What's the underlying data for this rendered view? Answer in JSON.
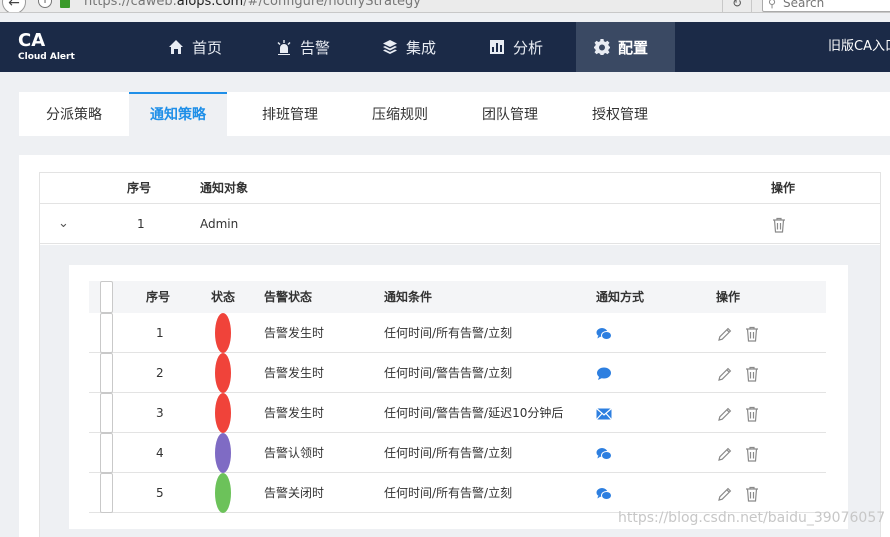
{
  "browser": {
    "url_prefix": "https://caweb.",
    "url_host": "alops.com",
    "url_path": "/#/configure/notifyStrategy",
    "search_placeholder": "Search"
  },
  "nav": {
    "logo_main": "CA",
    "logo_sub": "Cloud Alert",
    "items": [
      {
        "label": "首页",
        "icon": "home-icon"
      },
      {
        "label": "告警",
        "icon": "alarm-icon"
      },
      {
        "label": "集成",
        "icon": "layers-icon"
      },
      {
        "label": "分析",
        "icon": "chart-icon"
      },
      {
        "label": "配置",
        "icon": "gear-icon",
        "active": true
      }
    ],
    "right_link": "旧版CA入口"
  },
  "subtabs": [
    "分派策略",
    "通知策略",
    "排班管理",
    "压缩规则",
    "团队管理",
    "授权管理"
  ],
  "outer_table": {
    "headers": {
      "index": "序号",
      "target": "通知对象",
      "ops": "操作"
    },
    "row": {
      "index": "1",
      "target": "Admin"
    }
  },
  "inner_table": {
    "headers": {
      "index": "序号",
      "status": "状态",
      "alarm_status": "告警状态",
      "condition": "通知条件",
      "method": "通知方式",
      "ops": "操作"
    },
    "rows": [
      {
        "index": "1",
        "status_color": "#f0433a",
        "alarm_status": "告警发生时",
        "condition": "任何时间/所有告警/立刻",
        "method": "wechat-icon"
      },
      {
        "index": "2",
        "status_color": "#f0433a",
        "alarm_status": "告警发生时",
        "condition": "任何时间/警告告警/立刻",
        "method": "sms-icon"
      },
      {
        "index": "3",
        "status_color": "#f0433a",
        "alarm_status": "告警发生时",
        "condition": "任何时间/警告告警/延迟10分钟后",
        "method": "email-icon"
      },
      {
        "index": "4",
        "status_color": "#7f6bc4",
        "alarm_status": "告警认领时",
        "condition": "任何时间/所有告警/立刻",
        "method": "wechat-icon"
      },
      {
        "index": "5",
        "status_color": "#6cc25a",
        "alarm_status": "告警关闭时",
        "condition": "任何时间/所有告警/立刻",
        "method": "wechat-icon"
      }
    ]
  },
  "watermark": "https://blog.csdn.net/baidu_39076057",
  "colors": {
    "nav_bg": "#1b2a47",
    "accent": "#1f8fe8",
    "icon_blue": "#2d7fe0"
  }
}
